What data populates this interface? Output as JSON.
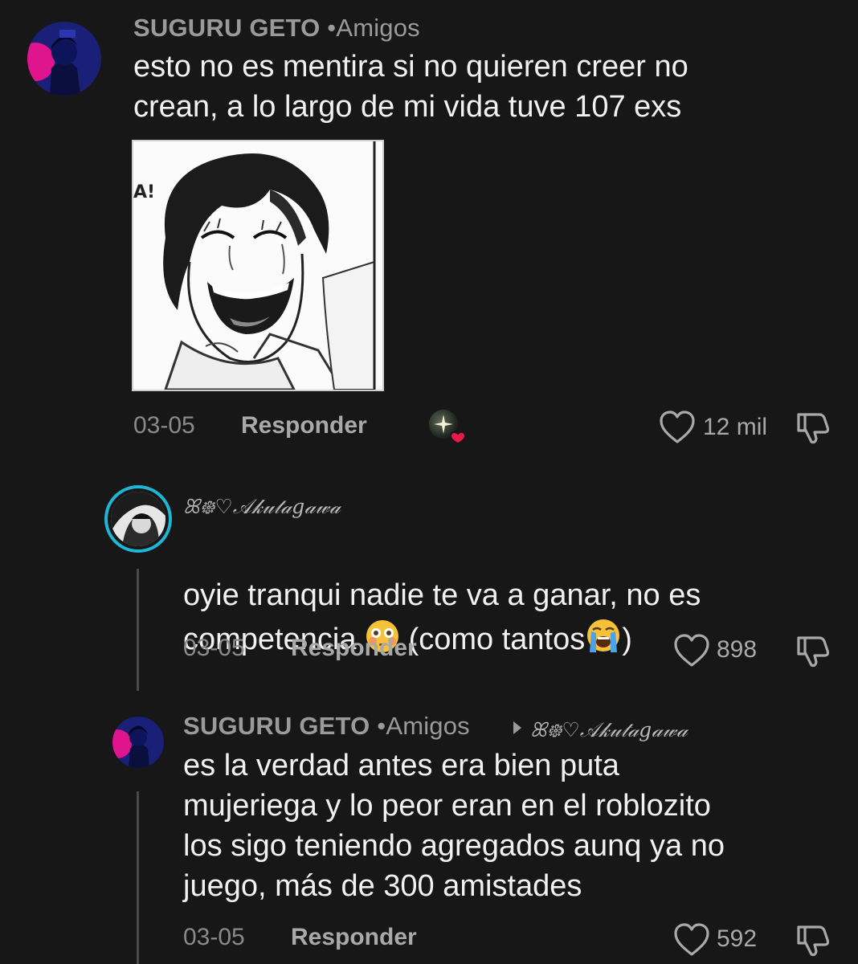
{
  "comments": [
    {
      "username": "SUGURU GETO",
      "friends_tag": "•Amigos",
      "text": "esto no es mentira si no quieren creer no\ncrean, a lo largo de mi vida tuve 107 exs",
      "image_icon": "manga-panel-laughing-crying",
      "date": "03-05",
      "reply_label": "Responder",
      "likes": "12 mil"
    },
    {
      "username": "ꕤ᪥♡𝒜𝓀𝓊𝓉𝒶𝑔𝒶𝓌𝒶",
      "text_part1": "oyie tranqui nadie te va a ganar, no es\ncompetencia ",
      "text_part2": " (como tantos",
      "text_part3": ")",
      "date": "03-05",
      "reply_label": "Responder",
      "likes": "898"
    },
    {
      "username": "SUGURU GETO",
      "friends_tag": "•Amigos",
      "reply_to": "ꕤ᪥♡𝒜𝓀𝓊𝓉𝒶𝑔𝒶𝓌𝒶",
      "text": "es la verdad antes era bien puta\nmujeriega y lo peor eran en el roblozito\nlos sigo teniendo agregados aunq ya no\njuego, más de 300 amistades",
      "date": "03-05",
      "reply_label": "Responder",
      "likes": "592"
    }
  ],
  "colors": {
    "background": "#171717",
    "text": "#f1f1f1",
    "muted": "#9a9a9a",
    "story_ring": "#1fb6d6",
    "creator_like_heart": "#e8194a"
  }
}
